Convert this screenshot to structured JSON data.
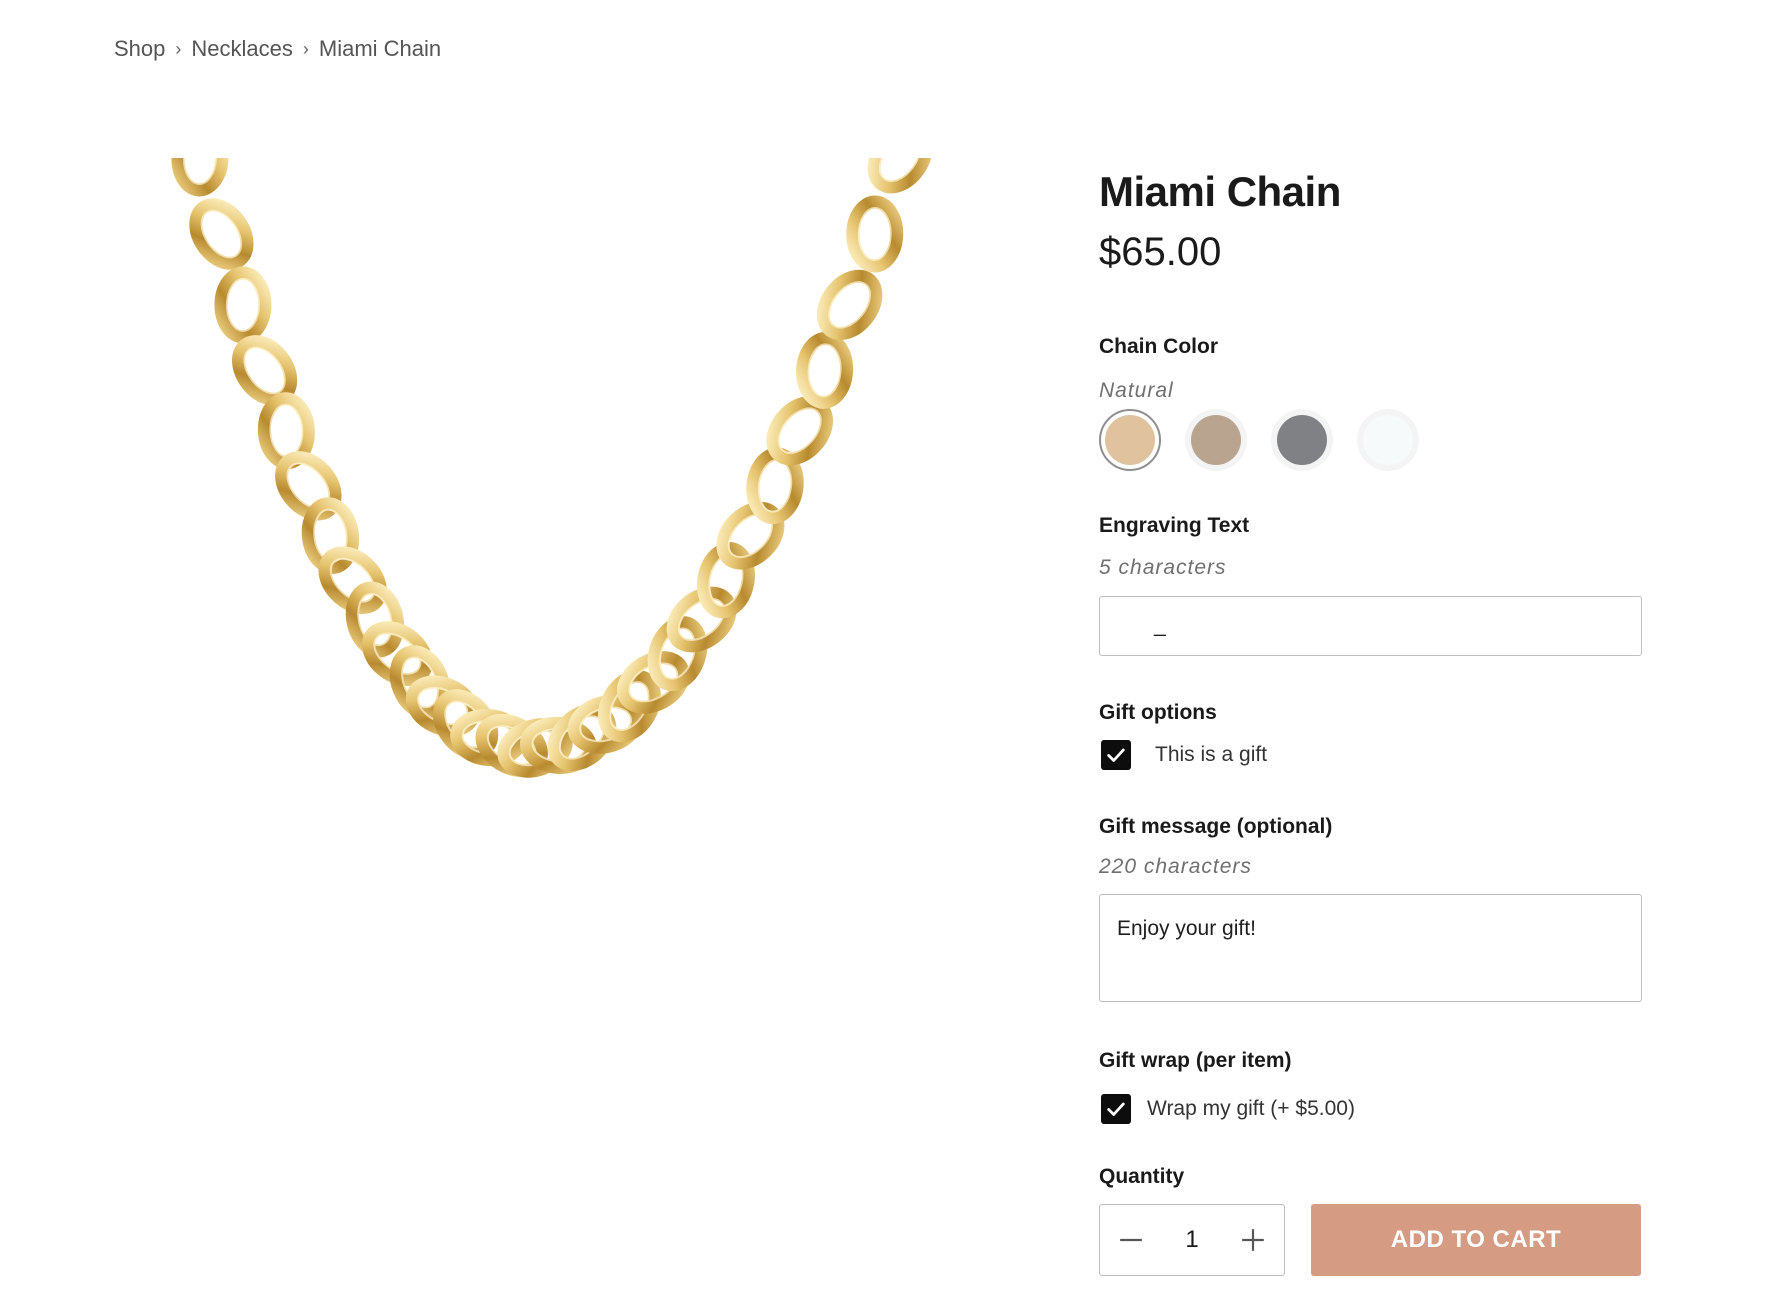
{
  "breadcrumb": {
    "items": [
      "Shop",
      "Necklaces",
      "Miami Chain"
    ],
    "separator": "›"
  },
  "product": {
    "title": "Miami Chain",
    "price": "$65.00",
    "image_icon": "gold-curb-chain-necklace"
  },
  "chain_color": {
    "label": "Chain Color",
    "selected": "Natural",
    "swatches": [
      {
        "color": "#e1c29e",
        "selected": true
      },
      {
        "color": "#b9a48f",
        "selected": false
      },
      {
        "color": "#808184",
        "selected": false
      },
      {
        "color": "#f7fafa",
        "selected": false
      }
    ]
  },
  "engraving": {
    "label": "Engraving Text",
    "limit_text": "5 characters",
    "value": "_"
  },
  "gift_options": {
    "label": "Gift options",
    "checkbox_label": "This is a gift",
    "checked": true
  },
  "gift_message": {
    "label": "Gift message (optional)",
    "limit_text": "220 characters",
    "value": "Enjoy your gift!"
  },
  "gift_wrap": {
    "label": "Gift wrap (per item)",
    "checkbox_label": "Wrap my gift (+ $5.00)",
    "checked": true
  },
  "quantity": {
    "label": "Quantity",
    "value": "1"
  },
  "cart": {
    "button_label": "ADD TO CART",
    "button_color": "#d59c83"
  }
}
